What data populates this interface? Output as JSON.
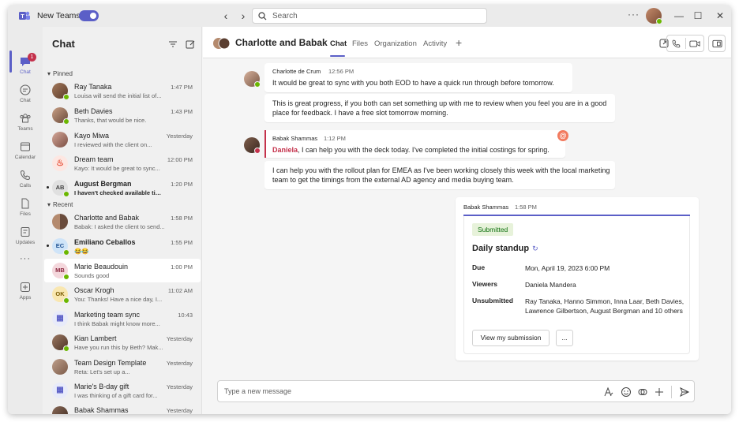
{
  "titlebar": {
    "app_name": "New Teams",
    "search_placeholder": "Search",
    "more": "···"
  },
  "rail": {
    "items": [
      {
        "label": "Chat",
        "icon": "chat-icon",
        "badge": "1"
      },
      {
        "label": "Chat",
        "icon": "chat-icon"
      },
      {
        "label": "Teams",
        "icon": "teams-icon"
      },
      {
        "label": "Calendar",
        "icon": "calendar-icon"
      },
      {
        "label": "Calls",
        "icon": "calls-icon"
      },
      {
        "label": "Files",
        "icon": "files-icon"
      },
      {
        "label": "Updates",
        "icon": "updates-icon"
      },
      {
        "label": "···",
        "icon": "more-icon"
      },
      {
        "label": "Apps",
        "icon": "apps-icon"
      }
    ]
  },
  "chatlist": {
    "title": "Chat",
    "pinned_label": "Pinned",
    "recent_label": "Recent",
    "pinned": [
      {
        "name": "Ray Tanaka",
        "preview": "Louisa will send the initial list of...",
        "time": "1:47 PM"
      },
      {
        "name": "Beth Davies",
        "preview": "Thanks, that would be nice.",
        "time": "1:43 PM"
      },
      {
        "name": "Kayo Miwa",
        "preview": "I reviewed with the client on...",
        "time": "Yesterday"
      },
      {
        "name": "Dream team",
        "preview": "Kayo: It would be great to sync...",
        "time": "12:00 PM"
      },
      {
        "name": "August Bergman",
        "initials": "AB",
        "preview": "I haven't checked available time...",
        "time": "1:20 PM",
        "unread": true
      }
    ],
    "recent": [
      {
        "name": "Charlotte and Babak",
        "preview": "Babak: I asked the client to send...",
        "time": "1:58 PM"
      },
      {
        "name": "Emiliano Ceballos",
        "initials": "EC",
        "preview": "😂😂",
        "time": "1:55 PM",
        "unread": true
      },
      {
        "name": "Marie Beaudouin",
        "initials": "MB",
        "preview": "Sounds good",
        "time": "1:00 PM",
        "selected": true
      },
      {
        "name": "Oscar Krogh",
        "initials": "OK",
        "preview": "You: Thanks! Have a nice day, I...",
        "time": "11:02 AM"
      },
      {
        "name": "Marketing team sync",
        "preview": "I think Babak might know more...",
        "time": "10:43"
      },
      {
        "name": "Kian Lambert",
        "preview": "Have you run this by Beth? Mak...",
        "time": "Yesterday"
      },
      {
        "name": "Team Design Template",
        "preview": "Reta: Let's set up a...",
        "time": "Yesterday"
      },
      {
        "name": "Marie's B-day gift",
        "preview": "I was thinking of a gift card for...",
        "time": "Yesterday"
      },
      {
        "name": "Babak Shammas",
        "preview": "",
        "time": "Yesterday"
      }
    ]
  },
  "conversation": {
    "title": "Charlotte and Babak",
    "tabs": [
      "Chat",
      "Files",
      "Organization",
      "Activity"
    ],
    "messages": [
      {
        "author": "Charlotte de Crum",
        "time": "12:56 PM",
        "paragraphs": [
          "It would be great to sync with you both EOD to have a quick run through before tomorrow.",
          "This is great progress, if you both can set something up with me to review when you feel you are in a good place for feedback. I have a free slot tomorrow morning."
        ]
      },
      {
        "author": "Babak Shammas",
        "time": "1:12 PM",
        "mention": "Daniela",
        "line1_rest": ", I can help you with the deck today. I've completed the initial costings for spring.",
        "paragraph2": "I can help you with the rollout plan for EMEA as I've been working closely this week with the local marketing team to get the timings from the external AD agency and media buying team."
      }
    ],
    "card": {
      "author": "Babak Shammas",
      "time": "1:58 PM",
      "status": "Submitted",
      "title": "Daily standup",
      "facts": [
        {
          "key": "Due",
          "value": "Mon, April 19, 2023 6:00 PM"
        },
        {
          "key": "Viewers",
          "value": "Daniela Mandera"
        },
        {
          "key": "Unsubmitted",
          "value": "Ray Tanaka, Hanno Simmon, Inna Laar, Beth Davies, Lawrence Gilbertson, August Bergman and 10 others"
        }
      ],
      "button_view": "View my submission",
      "button_more": "..."
    },
    "compose_placeholder": "Type a new message"
  },
  "colors": {
    "brand": "#5b5fc7",
    "presence_available": "#6bb700",
    "mention": "#c4314b",
    "submitted_bg": "#e7f2da",
    "submitted_fg": "#0e700e"
  }
}
